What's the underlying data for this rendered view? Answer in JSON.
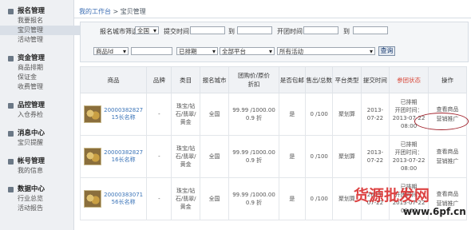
{
  "sidebar": {
    "sections": [
      {
        "title": "报名管理",
        "items": [
          "我要报名",
          "宝贝管理",
          "活动管理"
        ],
        "active": 1
      },
      {
        "title": "资金管理",
        "items": [
          "商品排期",
          "保证金",
          "收费管理"
        ]
      },
      {
        "title": "品控管理",
        "items": [
          "入仓券检"
        ]
      },
      {
        "title": "消息中心",
        "items": [
          "宝贝提醒"
        ]
      },
      {
        "title": "帐号管理",
        "items": [
          "我的信息"
        ]
      },
      {
        "title": "数据中心",
        "items": [
          "行业总览",
          "活动报告"
        ]
      }
    ]
  },
  "breadcrumb": {
    "link": "我的工作台",
    "sep": " > ",
    "current": "宝贝管理"
  },
  "filter": {
    "city_label": "报名城市筛选",
    "city_value": "全国",
    "submit_time_label": "提交时间",
    "to1": "到",
    "open_time_label": "开团时间",
    "to2": "到",
    "product_id_select": "商品Id",
    "status_select": "已排期",
    "platform_select": "全部平台",
    "activity_select": "所有活动",
    "query_button": "查询"
  },
  "table": {
    "columns": [
      "商品",
      "品牌",
      "类目",
      "报名城市",
      "团购价/原价\n折扣",
      "是否包邮",
      "售出/总数",
      "平台类型",
      "提交时间",
      "参团状态",
      "操作"
    ],
    "rows": [
      {
        "id": "20000382827",
        "name": "15长名称",
        "brand": "-",
        "category": "珠宝/钻石/翡翠/黄金",
        "city": "全国",
        "price": "99.99 /1000.00",
        "discount": "0.9 折",
        "shipping": "是",
        "sold": "0 /100",
        "platform": "聚划算",
        "submit_time": "2013-07-22",
        "status": "已排期",
        "open_time": "开团时间：2013-07-22 08:00",
        "ops": [
          "查看商品",
          "营销推广"
        ]
      },
      {
        "id": "20000382827",
        "name": "16长名称",
        "brand": "-",
        "category": "珠宝/钻石/翡翠/黄金",
        "city": "全国",
        "price": "99.99 /1000.00",
        "discount": "0.9 折",
        "shipping": "是",
        "sold": "0 /100",
        "platform": "聚划算",
        "submit_time": "2013-07-22",
        "status": "已排期",
        "open_time": "开团时间：2013-07-22 08:00",
        "ops": [
          "查看商品",
          "营销推广"
        ]
      },
      {
        "id": "20000383071",
        "name": "56长名称",
        "brand": "-",
        "category": "珠宝/钻石/翡翠/黄金",
        "city": "全国",
        "price": "99.99 /1000.00",
        "discount": "0.9 折",
        "shipping": "是",
        "sold": "0 /100",
        "platform": "聚划算",
        "submit_time": "2013-07-22",
        "status": "已排期",
        "open_time": "开团时间：2013-07-22 08:00",
        "ops": [
          "查看商品",
          "营销推广"
        ]
      }
    ]
  },
  "watermark": {
    "text": "货源批发网",
    "url": "www.6pf.cn"
  },
  "colors": {
    "accent": "#3b74b8",
    "status": "#d94a3b",
    "highlight_circle": "#a1202a"
  }
}
